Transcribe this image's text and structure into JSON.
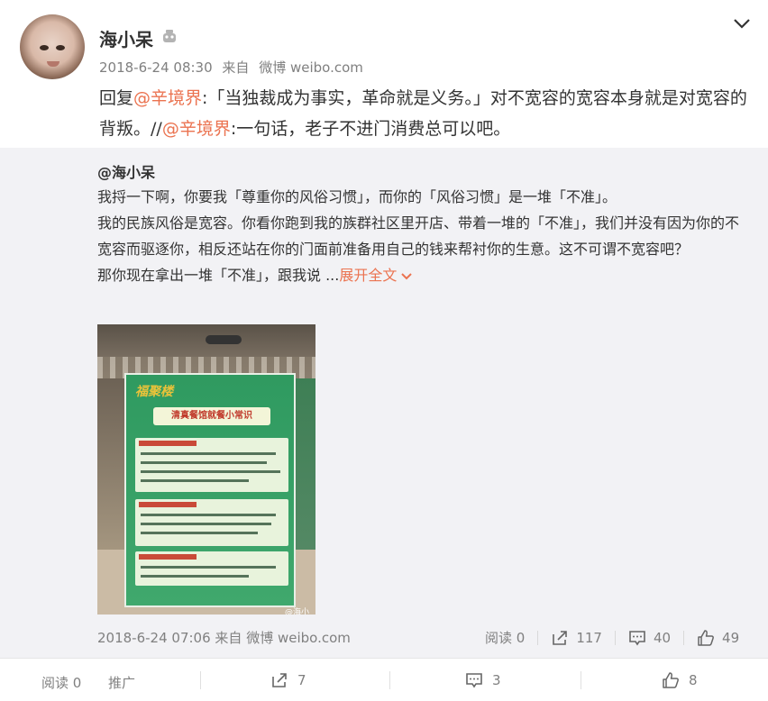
{
  "post": {
    "username": "海小呆",
    "timestamp": "2018-6-24 08:30",
    "source_prefix": "来自",
    "source": "微博 weibo.com",
    "text_before": "回复",
    "mention1": "@辛境界",
    "text_middle": ":「当独裁成为事实，革命就是义务。」对不宽容的宽容本身就是对宽容的背叛。//",
    "mention2": "@辛境界",
    "text_after": ":一句话，老子不进门消费总可以吧。"
  },
  "repost": {
    "author": "@海小呆",
    "para1": "我捋一下啊，你要我「尊重你的风俗习惯」，而你的「风俗习惯」是一堆「不准」。",
    "para2": "我的民族风俗是宽容。你看你跑到我的族群社区里开店、带着一堆的「不准」，我们并没有因为你的不宽容而驱逐你，相反还站在你的门面前准备用自己的钱来帮衬你的生意。这不可谓不宽容吧？",
    "para3": "那你现在拿出一堆「不准」，跟我说 ...",
    "expand_label": "展开全文",
    "photo": {
      "poster_brand": "福聚楼",
      "poster_title": "清真餐馆就餐小常识",
      "watermark": "@海小呆"
    },
    "timestamp": "2018-6-24 07:06",
    "source_prefix": "来自",
    "source": "微博 weibo.com",
    "reads": "阅读 0",
    "reposts": "117",
    "comments": "40",
    "likes": "49"
  },
  "toolbar": {
    "reads": "阅读 0",
    "promote": "推广",
    "reposts": "7",
    "comments": "3",
    "likes": "8"
  },
  "icons": {
    "badge": "crown-badge-icon",
    "menu": "chevron-down-icon",
    "repost": "share-icon",
    "comment": "comment-icon",
    "like": "thumbs-up-icon"
  },
  "colors": {
    "link": "#eb7350",
    "muted": "#808080",
    "repost_bg": "#f2f2f5"
  }
}
